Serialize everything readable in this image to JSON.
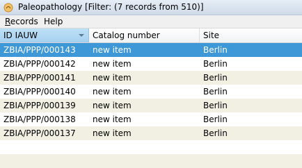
{
  "window": {
    "title": "Paleopathology [Filter: (7 records from 510)]"
  },
  "menubar": {
    "items": [
      {
        "label_first": "R",
        "label_rest": "ecords"
      },
      {
        "label_first": "",
        "label_rest": "Help"
      }
    ]
  },
  "table": {
    "columns": [
      "ID IAUW",
      "Catalog number",
      "Site"
    ],
    "rows": [
      {
        "id": "ZBIA/PPP/000143",
        "catalog": "new item",
        "site": "Berlin",
        "selected": true
      },
      {
        "id": "ZBIA/PPP/000142",
        "catalog": "new item",
        "site": "Berlin"
      },
      {
        "id": "ZBIA/PPP/000141",
        "catalog": "new item",
        "site": "Berlin"
      },
      {
        "id": "ZBIA/PPP/000140",
        "catalog": "new item",
        "site": "Berlin"
      },
      {
        "id": "ZBIA/PPP/000139",
        "catalog": "new item",
        "site": "Berlin"
      },
      {
        "id": "ZBIA/PPP/000138",
        "catalog": "new item",
        "site": "Berlin"
      },
      {
        "id": "ZBIA/PPP/000137",
        "catalog": "new item",
        "site": "Berlin"
      }
    ]
  },
  "colors": {
    "selection": "#3e97d6",
    "row_alt": "#f1f0e3",
    "sorted_header": "#bfe0f7"
  },
  "icons": {
    "app": "app-icon",
    "sort": "sort-descending-icon"
  }
}
